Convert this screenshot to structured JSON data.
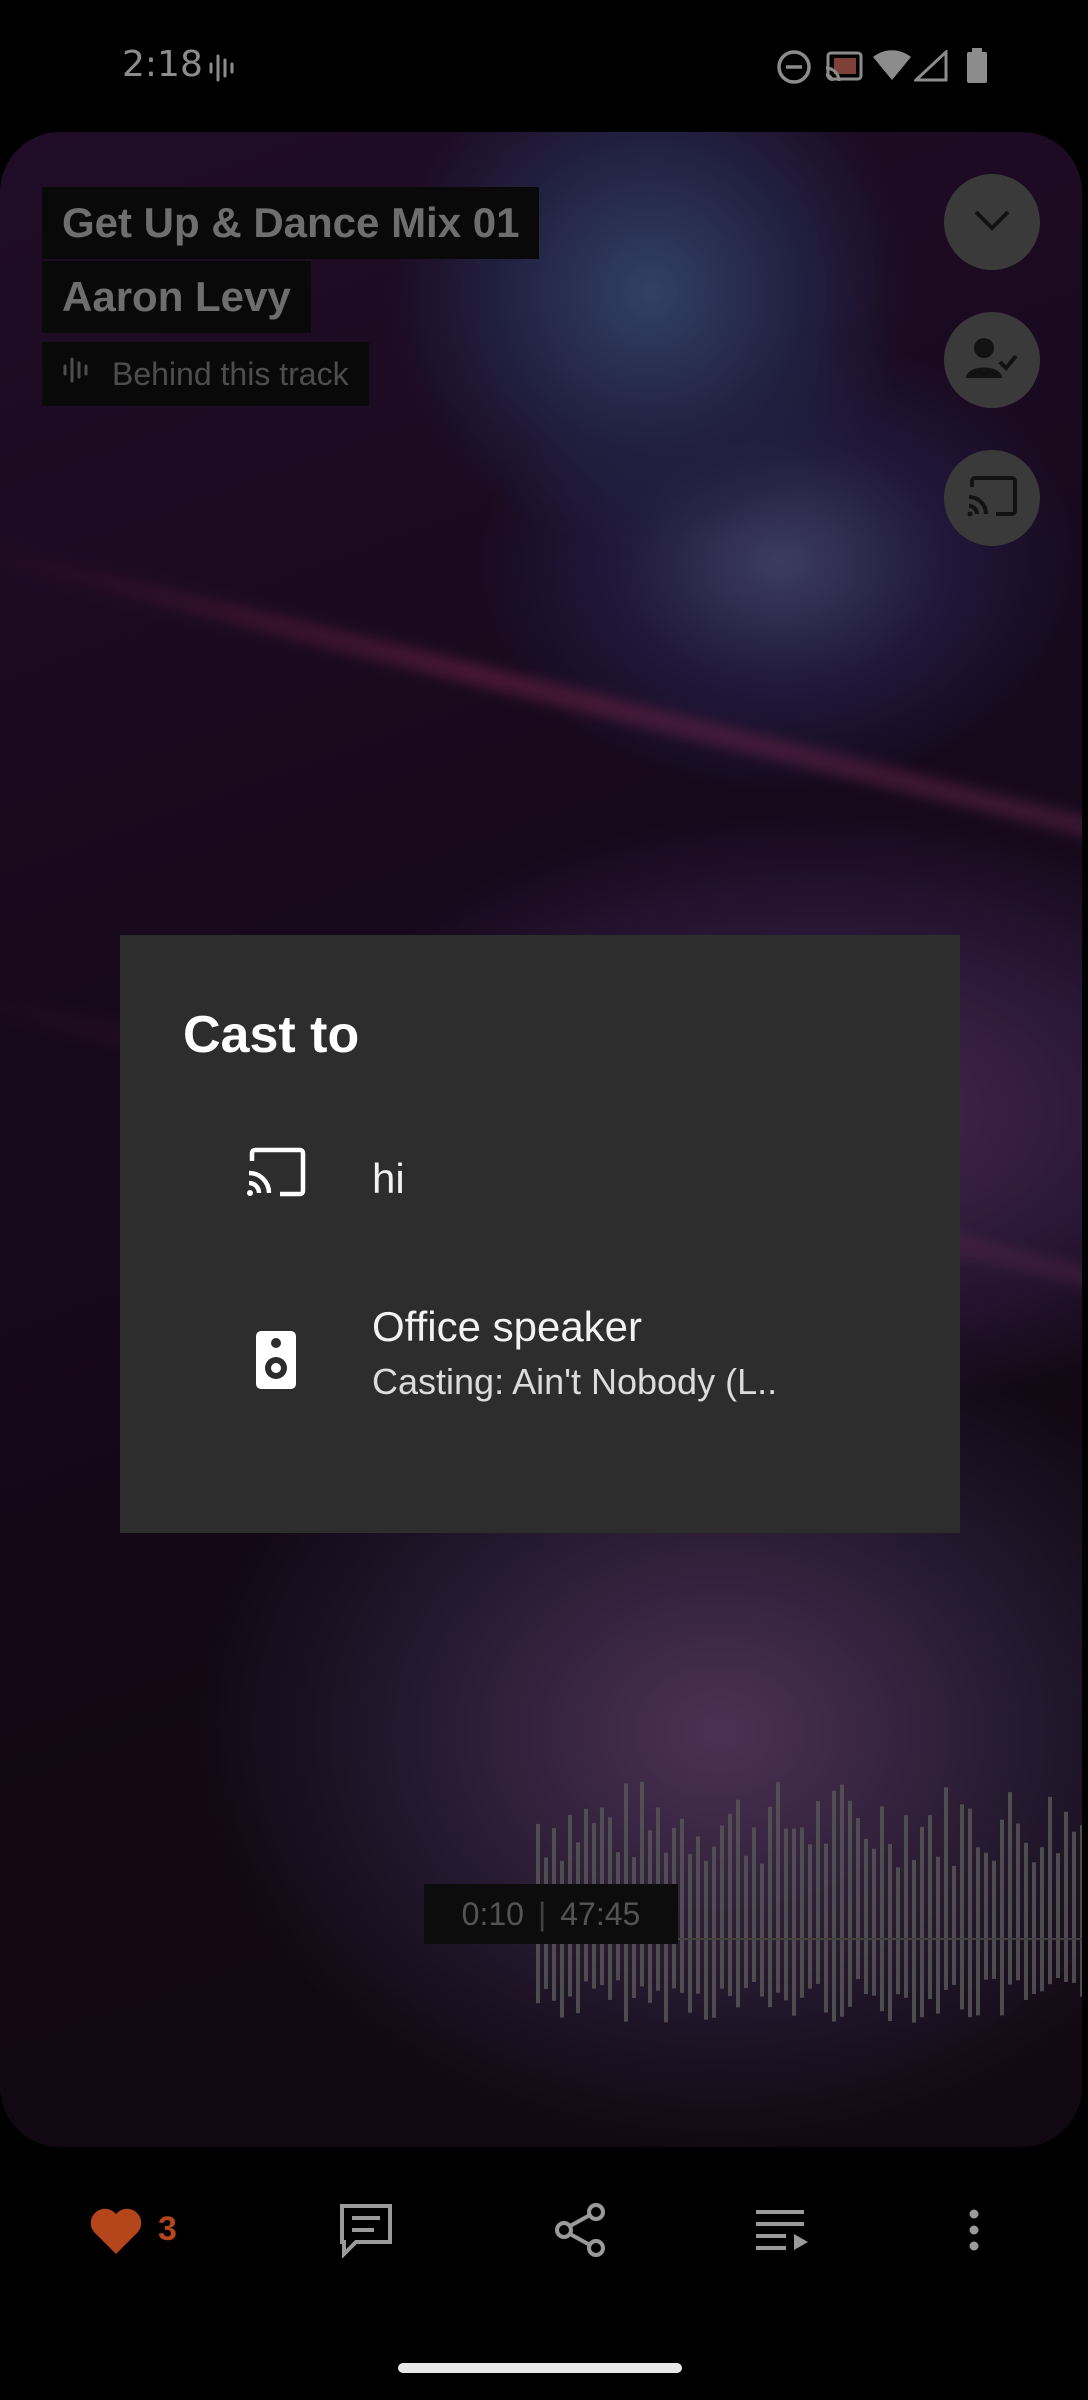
{
  "status_bar": {
    "time": "2:18",
    "icons": [
      "voice-activity-icon",
      "do-not-disturb-icon",
      "cast-connected-icon",
      "wifi-icon",
      "signal-icon",
      "battery-icon"
    ]
  },
  "player": {
    "track_title": "Get Up & Dance Mix 01",
    "artist": "Aaron Levy",
    "behind_track_label": "Behind this track",
    "elapsed": "0:10",
    "separator": "|",
    "duration": "47:45",
    "progress_fraction": 0.0035
  },
  "dialog": {
    "title": "Cast to",
    "routes": [
      {
        "name": "hi",
        "subtitle": "",
        "icon": "cast-icon"
      },
      {
        "name": "Office speaker",
        "subtitle": "Casting: Ain't Nobody (L..",
        "icon": "speaker-icon"
      }
    ]
  },
  "actions": {
    "like_count": "3"
  },
  "colors": {
    "accent": "#b5451b",
    "dialog_bg": "#2d2d2d"
  }
}
